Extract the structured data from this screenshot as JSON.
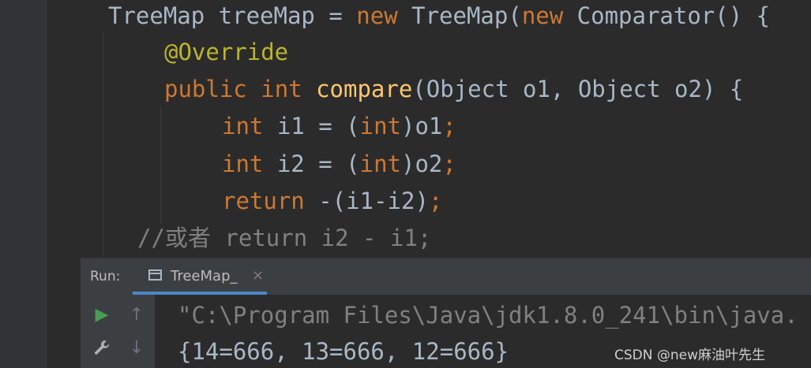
{
  "editor": {
    "line1": {
      "t1": "TreeMap",
      "t2": " treeMap = ",
      "t3": "new",
      "t4": " TreeMap(",
      "t5": "new",
      "t6": " Comparator() {"
    },
    "line2": {
      "t1": "@Override"
    },
    "line3": {
      "t1": "public",
      "t2": " ",
      "t3": "int",
      "t4": " ",
      "t5": "compare",
      "t6": "(Object o1, Object o2) {"
    },
    "line4": {
      "t1": "int",
      "t2": " i1 = (",
      "t3": "int",
      "t4": ")o1",
      "t5": ";"
    },
    "line5": {
      "t1": "int",
      "t2": " i2 = (",
      "t3": "int",
      "t4": ")o2",
      "t5": ";"
    },
    "line6": {
      "t1": "return",
      "t2": " -(i1-i2)",
      "t3": ";"
    },
    "line7": {
      "t1": "//",
      "t2": "或者",
      "t3": " return i2 - i1;"
    }
  },
  "run_panel": {
    "label": "Run:",
    "tab": {
      "icon": "console-window-icon",
      "label": "TreeMap_",
      "close": "×"
    },
    "tools": {
      "run": "▶",
      "up": "↑",
      "settings": "wrench-icon",
      "down": "↓"
    },
    "console": [
      "\"C:\\Program Files\\Java\\jdk1.8.0_241\\bin\\java.",
      "{14=666, 13=666, 12=666}"
    ]
  },
  "watermark": "CSDN @new麻油叶先生",
  "colors": {
    "keyword": "#cc7832",
    "annotation": "#bbb529",
    "method": "#ffc66d",
    "identifier": "#a9b7c6",
    "comment": "#808080",
    "run_green": "#499c54",
    "tab_underline": "#4a88c7"
  }
}
